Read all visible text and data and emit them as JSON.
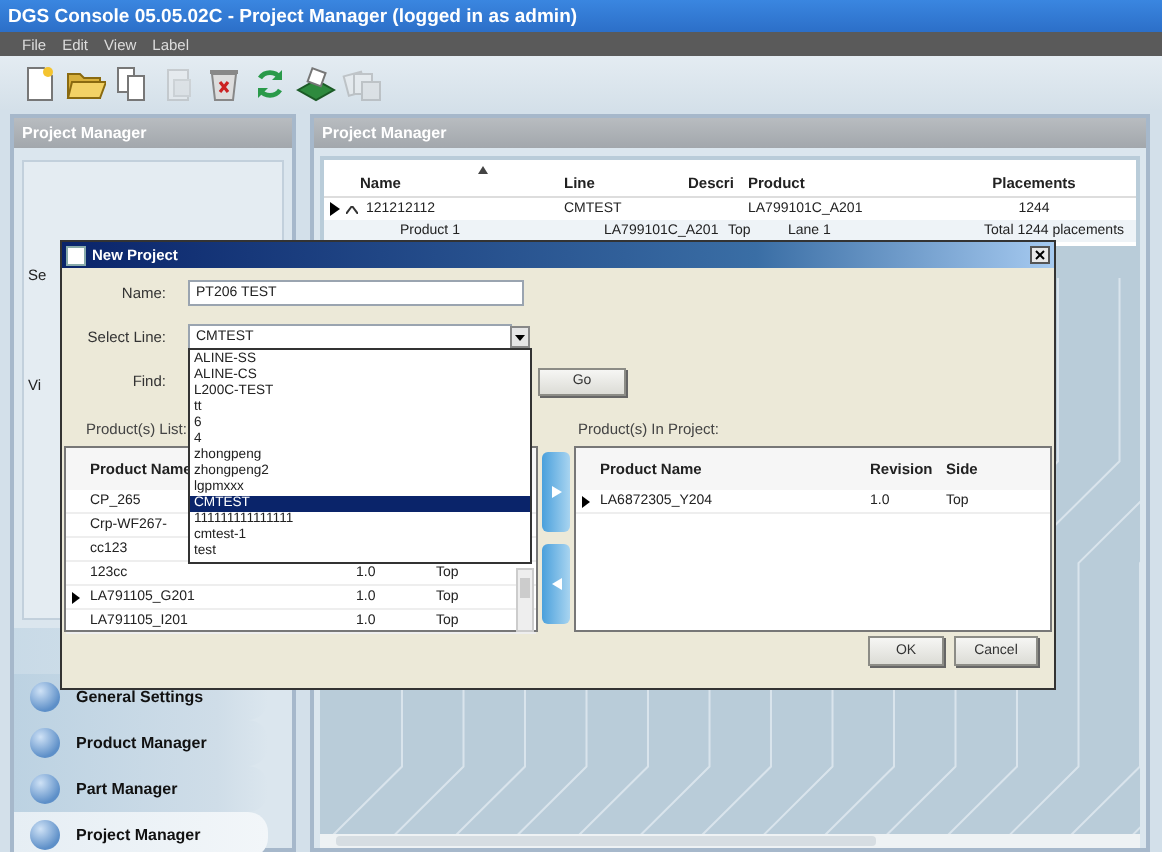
{
  "window": {
    "title": "DGS Console 05.05.02C - Project Manager (logged in as admin)"
  },
  "menu": [
    "File",
    "Edit",
    "View",
    "Label"
  ],
  "toolbar": [
    {
      "kind": "new",
      "disabled": false
    },
    {
      "kind": "open",
      "disabled": false
    },
    {
      "kind": "copy",
      "disabled": false
    },
    {
      "kind": "paste",
      "disabled": true
    },
    {
      "kind": "delete",
      "disabled": false
    },
    {
      "kind": "refresh",
      "disabled": false
    },
    {
      "kind": "board",
      "disabled": false
    },
    {
      "kind": "stack",
      "disabled": true
    }
  ],
  "left_panel": {
    "title": "Project Manager",
    "fragments": [
      "Se",
      "Vi"
    ],
    "nav": [
      {
        "label": "General Settings",
        "selected": false
      },
      {
        "label": "Product Manager",
        "selected": false
      },
      {
        "label": "Part Manager",
        "selected": false
      },
      {
        "label": "Project Manager",
        "selected": true
      }
    ]
  },
  "right_panel": {
    "title": "Project Manager",
    "table": {
      "columns": [
        "Name",
        "Line",
        "Descri",
        "Product",
        "Placements"
      ],
      "rows": [
        {
          "name": "121212112",
          "line": "CMTEST",
          "product": "LA799101C_A201",
          "placements": "1244",
          "selected": true,
          "expanded": true,
          "children": [
            {
              "name": "Product 1",
              "line": "LA799101C_A201",
              "descr": "Top",
              "product": "Lane 1",
              "placements": "Total 1244 placements",
              "selected": false
            }
          ]
        }
      ]
    }
  },
  "dialog": {
    "title": "New Project",
    "name_label": "Name:",
    "name_value": "PT206 TEST",
    "line_label": "Select Line:",
    "line_value": "CMTEST",
    "find_label": "Find:",
    "go_button": "Go",
    "line_options": [
      {
        "label": "ALINE-SS",
        "selected": false
      },
      {
        "label": "ALINE-CS",
        "selected": false
      },
      {
        "label": "L200C-TEST",
        "selected": false
      },
      {
        "label": "tt",
        "selected": false
      },
      {
        "label": "6",
        "selected": false
      },
      {
        "label": "4",
        "selected": false
      },
      {
        "label": "zhongpeng",
        "selected": false
      },
      {
        "label": "zhongpeng2",
        "selected": false
      },
      {
        "label": "lgpmxxx",
        "selected": false
      },
      {
        "label": "CMTEST",
        "selected": true
      },
      {
        "label": "111111111111111",
        "selected": false
      },
      {
        "label": "cmtest-1",
        "selected": false
      },
      {
        "label": "test",
        "selected": false
      }
    ],
    "list_label": "Product(s) List:",
    "product_list": {
      "columns": [
        "Product Name"
      ],
      "rows": [
        {
          "name": "CP_265",
          "selected": false
        },
        {
          "name": "Crp-WF267-",
          "selected": false
        },
        {
          "name": "cc123",
          "selected": false
        },
        {
          "name": "123cc",
          "revision": "1.0",
          "side": "Top",
          "selected": false
        },
        {
          "name": "LA791105_G201",
          "revision": "1.0",
          "side": "Top",
          "selected": true
        },
        {
          "name": "LA791105_I201",
          "revision": "1.0",
          "side": "Top",
          "selected": false
        }
      ]
    },
    "project_label": "Product(s) In Project:",
    "project_table": {
      "columns": [
        "Product Name",
        "Revision",
        "Side"
      ],
      "rows": [
        {
          "name": "LA6872305_Y204",
          "revision": "1.0",
          "side": "Top",
          "selected": true
        }
      ]
    },
    "buttons": [
      "OK",
      "Cancel"
    ]
  }
}
